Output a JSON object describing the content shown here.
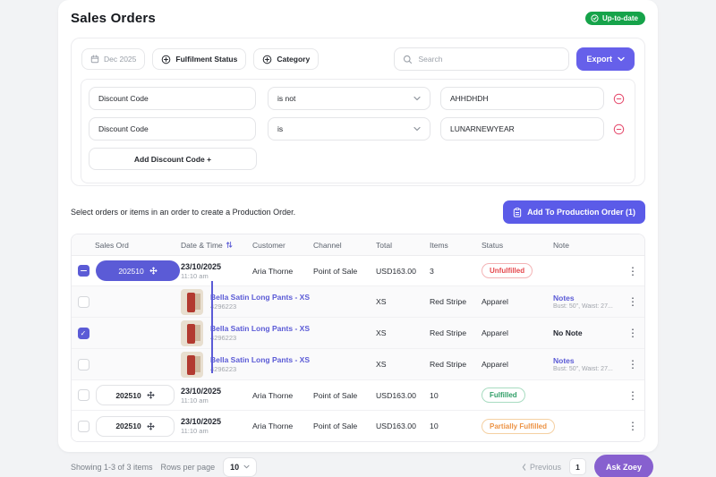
{
  "page": {
    "title": "Sales Orders",
    "uptodate_badge": "Up-to-date"
  },
  "toolbar": {
    "date_filter": "Dec 2025",
    "fulfilment_chip": "Fulfilment Status",
    "category_chip": "Category",
    "search_placeholder": "Search",
    "export_label": "Export"
  },
  "filter_builder": {
    "rows": [
      {
        "field": "Discount Code",
        "operator": "is not",
        "value": "AHHDHDH"
      },
      {
        "field": "Discount Code",
        "operator": "is",
        "value": "LUNARNEWYEAR"
      }
    ],
    "add_button_label": "Add Discount Code +"
  },
  "production_bar": {
    "hint": "Select orders or items in an order to create a Production Order.",
    "button_label": "Add To Production Order (1)"
  },
  "table": {
    "headers": {
      "sales_order": "Sales Ord",
      "date_time": "Date & Time",
      "customer": "Customer",
      "channel": "Channel",
      "total": "Total",
      "items": "Items",
      "status": "Status",
      "note": "Note"
    },
    "orders": [
      {
        "id": "202510",
        "date": "23/10/2025",
        "time": "11:10 am",
        "customer": "Aria Thorne",
        "channel": "Point of Sale",
        "total": "USD163.00",
        "items_count": "3",
        "status": "Unfulfilled",
        "line_items": [
          {
            "name": "Bella Satin Long Pants - XS",
            "sku": "4296223",
            "size": "XS",
            "items_value": "Red Stripe",
            "category": "Apparel",
            "note_title": "Notes",
            "note_detail": "Bust: 50\", Waist: 27..."
          },
          {
            "name": "Bella Satin Long Pants - XS",
            "sku": "4296223",
            "size": "XS",
            "items_value": "Red Stripe",
            "category": "Apparel",
            "note_title": "No Note",
            "note_detail": ""
          },
          {
            "name": "Bella Satin Long Pants - XS",
            "sku": "4296223",
            "size": "XS",
            "items_value": "Red Stripe",
            "category": "Apparel",
            "note_title": "Notes",
            "note_detail": "Bust: 50\", Waist: 27..."
          }
        ]
      },
      {
        "id": "202510",
        "date": "23/10/2025",
        "time": "11:10 am",
        "customer": "Aria Thorne",
        "channel": "Point of Sale",
        "total": "USD163.00",
        "items_count": "10",
        "status": "Fulfilled"
      },
      {
        "id": "202510",
        "date": "23/10/2025",
        "time": "11:10 am",
        "customer": "Aria Thorne",
        "channel": "Point of Sale",
        "total": "USD163.00",
        "items_count": "10",
        "status": "Partially Fulfilled"
      }
    ]
  },
  "footer": {
    "showing": "Showing 1-3 of 3 items",
    "rows_per_page_label": "Rows per page",
    "rows_per_page_value": "10",
    "previous_label": "Previous",
    "page_number": "1",
    "ask_zoey_label": "Ask Zoey"
  },
  "colors": {
    "accent": "#5B5BD6",
    "export_button": "#6660EA",
    "production_button": "#5B5BE8",
    "uptodate_green": "#16A34A",
    "fulfilled": "#2F9E66",
    "unfulfilled": "#E5484D",
    "partially_fulfilled": "#EC9345",
    "ask_zoey": "#8760CF"
  }
}
